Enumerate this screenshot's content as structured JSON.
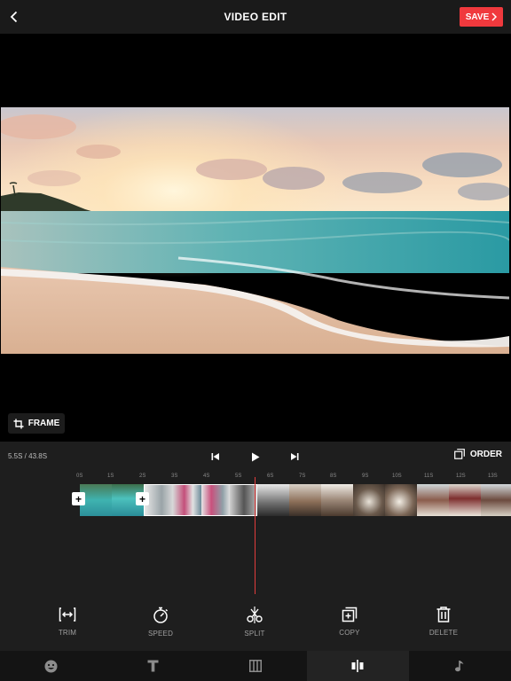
{
  "header": {
    "title": "VIDEO EDIT",
    "save_label": "SAVE",
    "back_icon": "chevron-left-icon"
  },
  "preview": {
    "frame_label": "FRAME"
  },
  "timeline": {
    "timecode": "5.5S / 43.8S",
    "order_label": "ORDER",
    "ticks": [
      "0S",
      "1S",
      "2S",
      "3S",
      "4S",
      "5S",
      "6S",
      "7S",
      "8S",
      "9S",
      "10S",
      "11S",
      "12S",
      "13S"
    ]
  },
  "tools": [
    {
      "label": "TRIM",
      "icon": "trim-icon"
    },
    {
      "label": "SPEED",
      "icon": "speed-icon"
    },
    {
      "label": "SPLIT",
      "icon": "split-icon"
    },
    {
      "label": "COPY",
      "icon": "copy-icon"
    },
    {
      "label": "DELETE",
      "icon": "delete-icon"
    }
  ],
  "tabs": [
    {
      "icon": "sticker-icon",
      "active": false
    },
    {
      "icon": "text-icon",
      "active": false
    },
    {
      "icon": "filter-icon",
      "active": false
    },
    {
      "icon": "edit-icon",
      "active": true
    },
    {
      "icon": "music-icon",
      "active": false
    }
  ],
  "colors": {
    "accent": "#f0393d",
    "playhead": "#e23c3c",
    "background": "#000000",
    "panel": "#1e1e1e"
  }
}
